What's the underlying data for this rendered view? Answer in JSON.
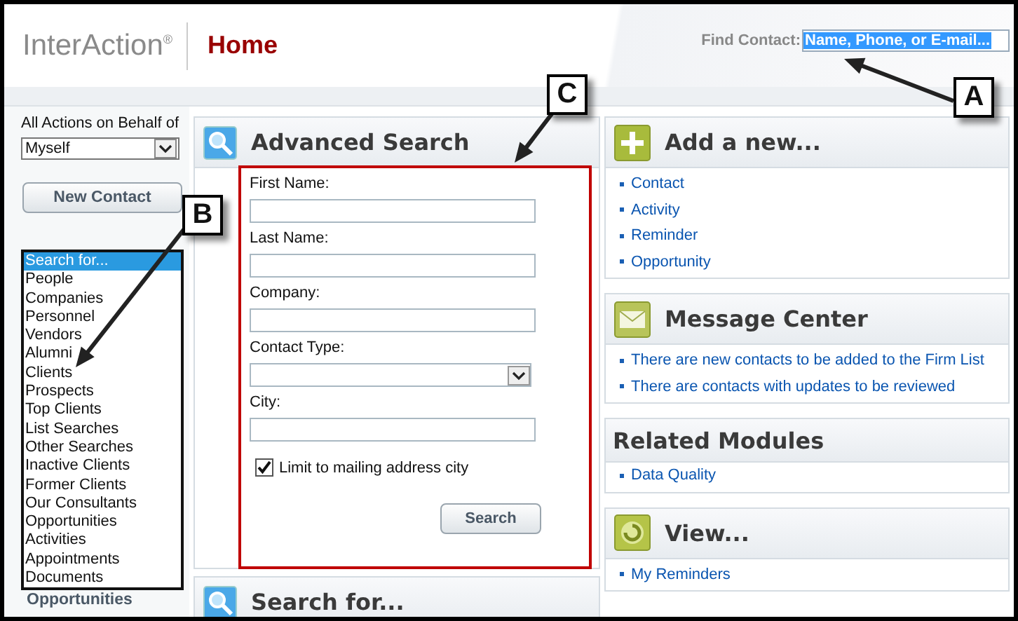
{
  "header": {
    "logo": "InterAction$^{®}$",
    "title": "Home",
    "find_contact": {
      "label": "Find Contact:",
      "value": "Name, Phone, or E-mail...",
      "highlighted": true
    }
  },
  "sidebar": {
    "behalf_label": "All Actions on Behalf of",
    "behalf_value": "Myself",
    "new_contact_button": "New Contact",
    "search_list": [
      {
        "label": "Search for...",
        "selected": true
      },
      {
        "label": "People",
        "selected": false
      },
      {
        "label": "Companies",
        "selected": false
      },
      {
        "label": "Personnel",
        "selected": false
      },
      {
        "label": "Vendors",
        "selected": false
      },
      {
        "label": "Alumni",
        "selected": false
      },
      {
        "label": "Clients",
        "selected": false
      },
      {
        "label": "Prospects",
        "selected": false
      },
      {
        "label": "Top Clients",
        "selected": false
      },
      {
        "label": "List Searches",
        "selected": false
      },
      {
        "label": "Other Searches",
        "selected": false
      },
      {
        "label": "Inactive Clients",
        "selected": false
      },
      {
        "label": "Former Clients",
        "selected": false
      },
      {
        "label": "Our Consultants",
        "selected": false
      },
      {
        "label": "Opportunities",
        "selected": false
      },
      {
        "label": "Activities",
        "selected": false
      },
      {
        "label": "Appointments",
        "selected": false
      },
      {
        "label": "Documents",
        "selected": false
      }
    ],
    "section_label": "Opportunities"
  },
  "advanced_search": {
    "title": "Advanced Search",
    "fields": [
      {
        "label": "First Name:",
        "kind": "text"
      },
      {
        "label": "Last Name:",
        "kind": "text"
      },
      {
        "label": "Company:",
        "kind": "text"
      },
      {
        "label": "Contact Type:",
        "kind": "select"
      },
      {
        "label": "City:",
        "kind": "text"
      }
    ],
    "checkbox": {
      "label": "Limit to mailing address city",
      "checked": true
    },
    "button": "Search"
  },
  "search_for_panel": {
    "title": "Search for..."
  },
  "right_panels": [
    {
      "kind": "add",
      "title": "Add a new...",
      "links": [
        "Contact",
        "Activity",
        "Reminder",
        "Opportunity"
      ]
    },
    {
      "kind": "messages",
      "title": "Message Center",
      "links": [
        "There are new contacts to be added to the Firm List",
        "There are contacts with updates to be reviewed"
      ]
    },
    {
      "kind": "plain",
      "title": "Related Modules",
      "links": [
        "Data Quality"
      ]
    },
    {
      "kind": "view",
      "title": "View...",
      "links": [
        "My Reminders"
      ]
    }
  ],
  "callouts": [
    {
      "label": "A"
    },
    {
      "label": "B"
    },
    {
      "label": "C"
    }
  ]
}
